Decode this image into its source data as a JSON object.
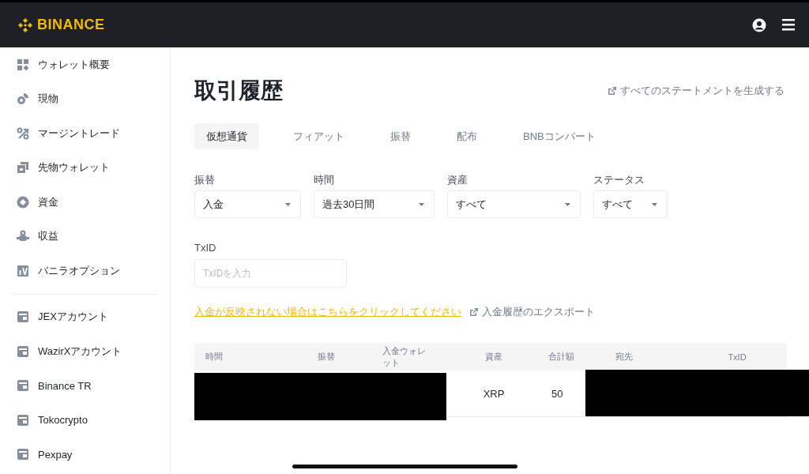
{
  "header": {
    "logo": "BINANCE"
  },
  "sidebar": {
    "sections": [
      [
        {
          "label": "ウォレット概要",
          "kind": "overview"
        },
        {
          "label": "現物",
          "kind": "spot"
        },
        {
          "label": "マージントレード",
          "kind": "margin"
        },
        {
          "label": "先物ウォレット",
          "kind": "futures"
        },
        {
          "label": "資金",
          "kind": "funding"
        },
        {
          "label": "収益",
          "kind": "earn"
        },
        {
          "label": "バニラオプション",
          "kind": "options"
        }
      ],
      [
        {
          "label": "JEXアカウント",
          "kind": "account"
        },
        {
          "label": "WazirXアカウント",
          "kind": "account"
        },
        {
          "label": "Binance TR",
          "kind": "account"
        },
        {
          "label": "Tokocrypto",
          "kind": "account"
        },
        {
          "label": "Pexpay",
          "kind": "account"
        }
      ]
    ]
  },
  "page": {
    "title": "取引履歴",
    "statement_link": "すべてのステートメントを生成する"
  },
  "tabs": [
    {
      "label": "仮想通貨",
      "selected": true
    },
    {
      "label": "フィアット",
      "selected": false
    },
    {
      "label": "振替",
      "selected": false
    },
    {
      "label": "配布",
      "selected": false
    },
    {
      "label": "BNBコンバート",
      "selected": false
    }
  ],
  "filters": [
    {
      "label": "振替",
      "value": "入金"
    },
    {
      "label": "時間",
      "value": "過去30日間"
    },
    {
      "label": "資産",
      "value": "すべて"
    },
    {
      "label": "ステータス",
      "value": "すべて"
    }
  ],
  "txid": {
    "label": "TxID",
    "placeholder": "TxIDを入力"
  },
  "help_link": "入金が反映されない場合はこちらをクリックしてください",
  "export_link": "入金履歴のエクスポート",
  "table": {
    "columns": [
      "時間",
      "振替",
      "入金ウォレット",
      "資産",
      "合計額",
      "宛先",
      "TxID"
    ],
    "rows": [
      {
        "asset": "XRP",
        "amount": "50",
        "redacted": true
      }
    ]
  }
}
